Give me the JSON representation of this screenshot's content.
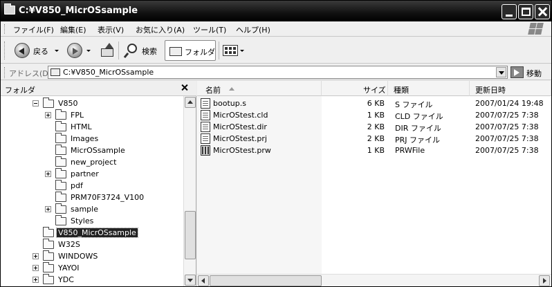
{
  "window": {
    "title": "C:¥V850_MicrOSsample"
  },
  "menu": [
    "ファイル(F)",
    "編集(E)",
    "表示(V)",
    "お気に入り(A)",
    "ツール(T)",
    "ヘルプ(H)"
  ],
  "toolbar": {
    "back_label": "戻る",
    "search_label": "検索",
    "folders_label": "フォルダ"
  },
  "address": {
    "label": "アドレス(D)",
    "value": "C:¥V850_MicrOSsample",
    "go_label": "移動"
  },
  "folder_pane": {
    "title": "フォルダ",
    "tree": [
      {
        "label": "V850",
        "level": 1,
        "expander": "minus",
        "selected": false
      },
      {
        "label": "FPL",
        "level": 2,
        "expander": "plus",
        "selected": false
      },
      {
        "label": "HTML",
        "level": 2,
        "expander": "",
        "selected": false
      },
      {
        "label": "Images",
        "level": 2,
        "expander": "",
        "selected": false
      },
      {
        "label": "MicrOSsample",
        "level": 2,
        "expander": "",
        "selected": false
      },
      {
        "label": "new_project",
        "level": 2,
        "expander": "",
        "selected": false
      },
      {
        "label": "partner",
        "level": 2,
        "expander": "plus",
        "selected": false
      },
      {
        "label": "pdf",
        "level": 2,
        "expander": "",
        "selected": false
      },
      {
        "label": "PRM70F3724_V100",
        "level": 2,
        "expander": "",
        "selected": false
      },
      {
        "label": "sample",
        "level": 2,
        "expander": "plus",
        "selected": false
      },
      {
        "label": "Styles",
        "level": 2,
        "expander": "",
        "selected": false
      },
      {
        "label": "V850_MicrOSsample",
        "level": 1,
        "expander": "",
        "selected": true
      },
      {
        "label": "W32S",
        "level": 1,
        "expander": "",
        "selected": false
      },
      {
        "label": "WINDOWS",
        "level": 1,
        "expander": "plus",
        "selected": false
      },
      {
        "label": "YAYOI",
        "level": 1,
        "expander": "plus",
        "selected": false
      },
      {
        "label": "YDC",
        "level": 1,
        "expander": "plus",
        "selected": false
      }
    ]
  },
  "file_list": {
    "columns": {
      "name": "名前",
      "size": "サイズ",
      "type": "種類",
      "modified": "更新日時"
    },
    "rows": [
      {
        "icon": "doc",
        "name": "bootup.s",
        "size": "6 KB",
        "type": "S ファイル",
        "modified": "2007/01/24 19:48"
      },
      {
        "icon": "doc",
        "name": "MicrOStest.cld",
        "size": "1 KB",
        "type": "CLD ファイル",
        "modified": "2007/07/25 7:38"
      },
      {
        "icon": "doc",
        "name": "MicrOStest.dir",
        "size": "2 KB",
        "type": "DIR ファイル",
        "modified": "2007/07/25 7:38"
      },
      {
        "icon": "doc",
        "name": "MicrOStest.prj",
        "size": "2 KB",
        "type": "PRJ ファイル",
        "modified": "2007/07/25 7:38"
      },
      {
        "icon": "prw",
        "name": "MicrOStest.prw",
        "size": "1 KB",
        "type": "PRWFile",
        "modified": "2007/07/25 7:38"
      }
    ]
  },
  "icons": [
    "folder-icon",
    "minimize-icon",
    "maximize-icon",
    "close-icon",
    "windows-logo-icon",
    "back-arrow-icon",
    "forward-arrow-icon",
    "up-folder-icon",
    "search-icon",
    "folders-icon",
    "views-icon",
    "chevron-down-icon",
    "go-arrow-icon",
    "file-icon"
  ]
}
